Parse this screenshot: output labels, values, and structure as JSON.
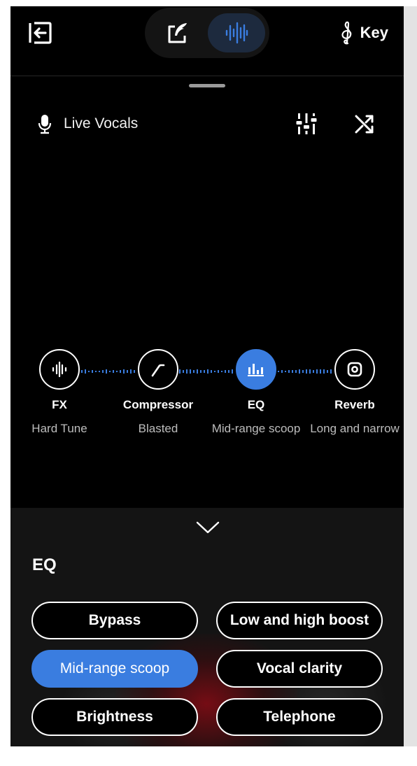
{
  "header": {
    "key_label": "Key",
    "mode_write_icon": "compose-icon",
    "mode_voice_icon": "waveform-icon"
  },
  "track": {
    "title": "Live Vocals",
    "mic_icon": "microphone-icon",
    "mixer_icon": "sliders-icon",
    "shuffle_icon": "shuffle-icon"
  },
  "chain": {
    "nodes": [
      {
        "title": "FX",
        "subtitle": "Hard Tune",
        "icon": "waveform-icon",
        "active": false
      },
      {
        "title": "Compressor",
        "subtitle": "Blasted",
        "icon": "compressor-curve-icon",
        "active": false
      },
      {
        "title": "EQ",
        "subtitle": "Mid-range scoop",
        "icon": "eq-bars-icon",
        "active": true
      },
      {
        "title": "Reverb",
        "subtitle": "Long and narrow",
        "icon": "reverb-icon",
        "active": false
      }
    ]
  },
  "panel": {
    "title": "EQ",
    "presets": [
      {
        "label": "Bypass",
        "selected": false
      },
      {
        "label": "Low and high boost",
        "selected": false
      },
      {
        "label": "Mid-range scoop",
        "selected": true
      },
      {
        "label": "Vocal clarity",
        "selected": false
      },
      {
        "label": "Brightness",
        "selected": false
      },
      {
        "label": "Telephone",
        "selected": false
      }
    ]
  },
  "colors": {
    "accent": "#3a7de0",
    "background": "#000000",
    "panel": "#141414"
  }
}
